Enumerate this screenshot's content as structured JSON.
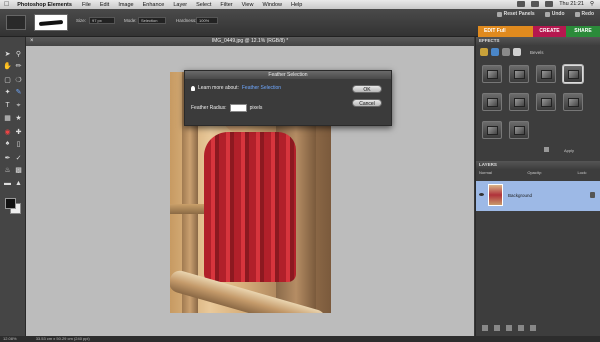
{
  "menubar": {
    "app_name": "Photoshop Elements",
    "items": [
      "File",
      "Edit",
      "Image",
      "Enhance",
      "Layer",
      "Select",
      "Filter",
      "View",
      "Window",
      "Help"
    ],
    "clock": "Thu 21:21"
  },
  "options": {
    "size_label": "Size:",
    "size_value": "97 px",
    "mode_label": "Mode:",
    "mode_value": "Selection",
    "hardness_label": "Hardness:",
    "hardness_value": "100%"
  },
  "top_actions": {
    "reset_panels": "Reset Panels",
    "undo": "Undo",
    "redo": "Redo"
  },
  "mode_tabs": {
    "edit": "EDIT Full",
    "create": "CREATE",
    "share": "SHARE"
  },
  "document": {
    "title": "IMG_0449.jpg @ 12.1% (RGB/8) *"
  },
  "dialog": {
    "title": "Feather Selection",
    "learn_prefix": "Learn more about:",
    "learn_link": "Feather Selection",
    "radius_label": "Feather Radius:",
    "radius_value": "",
    "units": "pixels",
    "ok_label": "OK",
    "cancel_label": "Cancel"
  },
  "effects": {
    "header": "EFFECTS",
    "category": "Bevels",
    "apply_label": "Apply"
  },
  "layers": {
    "header": "LAYERS",
    "blend_mode": "Normal",
    "opacity_label": "Opacity:",
    "lock_label": "Lock:",
    "layer_name": "Background"
  },
  "status": {
    "zoom": "12.08%",
    "dimensions": "33.53 cm x 50.29 cm (240 ppi)"
  },
  "colors": {
    "edit_tab": "#e08a1e",
    "create_tab": "#b5184f",
    "share_tab": "#2b8b3a",
    "selected_layer": "#9db9e6",
    "link": "#6fa8ff"
  }
}
